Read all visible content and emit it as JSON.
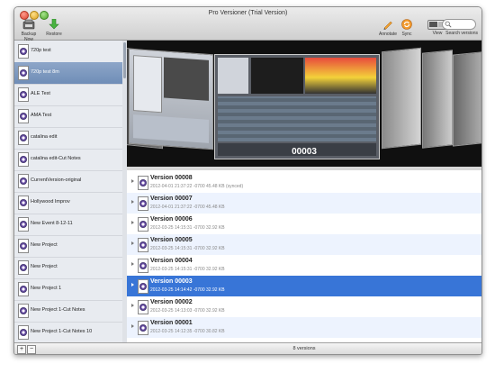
{
  "window": {
    "title": "Pro Versioner (Trial Version)"
  },
  "toolbar": {
    "backup_label": "Backup Now",
    "restore_label": "Restore",
    "annotate_label": "Annotate",
    "sync_label": "Sync",
    "view_label": "View",
    "search_label": "Search versions"
  },
  "sidebar": {
    "items": [
      {
        "label": "720p test"
      },
      {
        "label": "720p test 8m"
      },
      {
        "label": "ALE Test"
      },
      {
        "label": "AMA Test"
      },
      {
        "label": "catalina edit"
      },
      {
        "label": "catalina edit-Cut Notes"
      },
      {
        "label": "CurrentVersion-original"
      },
      {
        "label": "Hollywood Improv"
      },
      {
        "label": "New Event 8-12-11"
      },
      {
        "label": "New Project"
      },
      {
        "label": "New Project"
      },
      {
        "label": "New Project 1"
      },
      {
        "label": "New Project 1-Cut Notes"
      },
      {
        "label": "New Project 1-Cut Notes 10"
      }
    ],
    "selected_index": 1,
    "add_label": "+",
    "remove_label": "−"
  },
  "preview": {
    "current_frame": "00003"
  },
  "versions": [
    {
      "name": "Version 00008",
      "meta": "2012-04-01 21:37:22 -0700   45.48 KB (synced)"
    },
    {
      "name": "Version 00007",
      "meta": "2012-04-01 21:37:22 -0700   45.48 KB"
    },
    {
      "name": "Version 00006",
      "meta": "2012-03-25 14:15:31 -0700   32.92 KB"
    },
    {
      "name": "Version 00005",
      "meta": "2012-03-25 14:15:31 -0700   32.92 KB"
    },
    {
      "name": "Version 00004",
      "meta": "2012-03-25 14:15:31 -0700   32.92 KB"
    },
    {
      "name": "Version 00003",
      "meta": "2012-03-25 14:14:42 -0700   32.92 KB"
    },
    {
      "name": "Version 00002",
      "meta": "2012-03-25 14:13:03 -0700   32.92 KB"
    },
    {
      "name": "Version 00001",
      "meta": "2012-03-25 14:12:35 -0700   30.82 KB"
    }
  ],
  "selected_version_index": 5,
  "status": {
    "count": "8 versions"
  },
  "colors": {
    "selection": "#3875d7",
    "sidebar_selection": "#7a96be",
    "row_alt": "#edf3fe"
  }
}
